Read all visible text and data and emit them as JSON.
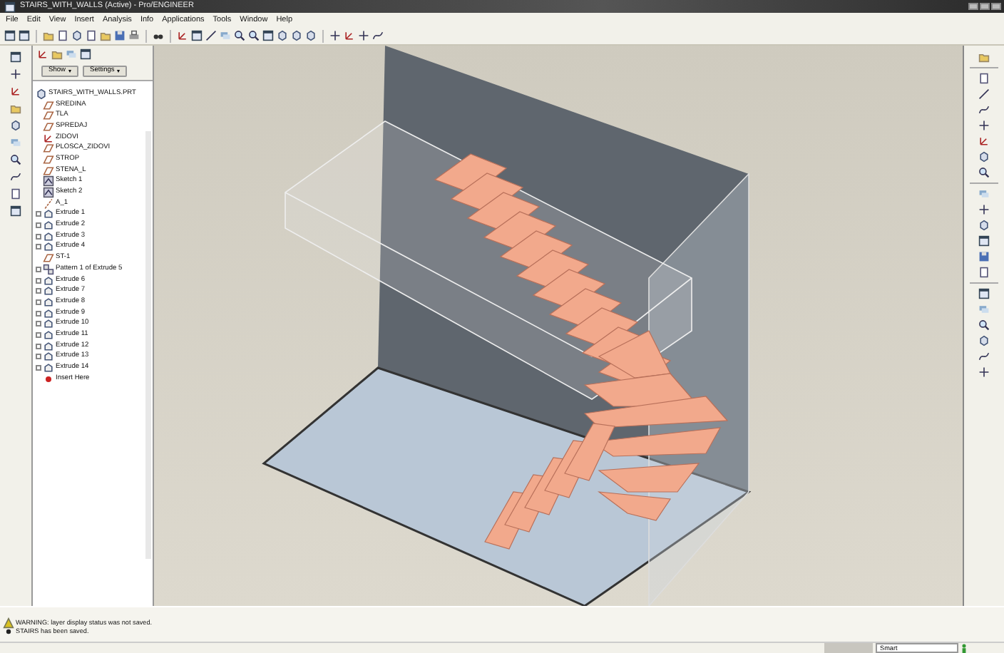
{
  "window": {
    "title": "STAIRS_WITH_WALLS (Active) - Pro/ENGINEER"
  },
  "menu": [
    "File",
    "Edit",
    "View",
    "Insert",
    "Analysis",
    "Info",
    "Applications",
    "Tools",
    "Window",
    "Help"
  ],
  "tree_panel": {
    "buttons": [
      "Show",
      "Settings"
    ],
    "items": [
      {
        "label": "STAIRS_WITH_WALLS.PRT",
        "kind": "part"
      },
      {
        "label": "SREDINA",
        "kind": "plane"
      },
      {
        "label": "TLA",
        "kind": "plane"
      },
      {
        "label": "SPREDAJ",
        "kind": "plane"
      },
      {
        "label": "ZIDOVI",
        "kind": "csys"
      },
      {
        "label": "PLOSCA_ZIDOVI",
        "kind": "plane"
      },
      {
        "label": "STROP",
        "kind": "plane"
      },
      {
        "label": "STENA_L",
        "kind": "plane"
      },
      {
        "label": "Sketch 1",
        "kind": "sketch"
      },
      {
        "label": "Sketch 2",
        "kind": "sketch"
      },
      {
        "label": "A_1",
        "kind": "axis"
      },
      {
        "label": "Extrude 1",
        "kind": "extrude"
      },
      {
        "label": "Extrude 2",
        "kind": "extrude"
      },
      {
        "label": "Extrude 3",
        "kind": "extrude"
      },
      {
        "label": "Extrude 4",
        "kind": "extrude"
      },
      {
        "label": "ST-1",
        "kind": "plane"
      },
      {
        "label": "Pattern 1 of Extrude 5",
        "kind": "pattern"
      },
      {
        "label": "Extrude 6",
        "kind": "extrude"
      },
      {
        "label": "Extrude 7",
        "kind": "extrude"
      },
      {
        "label": "Extrude 8",
        "kind": "extrude"
      },
      {
        "label": "Extrude 9",
        "kind": "extrude"
      },
      {
        "label": "Extrude 10",
        "kind": "extrude"
      },
      {
        "label": "Extrude 11",
        "kind": "extrude"
      },
      {
        "label": "Extrude 12",
        "kind": "extrude"
      },
      {
        "label": "Extrude 13",
        "kind": "extrude"
      },
      {
        "label": "Extrude 14",
        "kind": "extrude"
      },
      {
        "label": "Insert Here",
        "kind": "insert"
      }
    ]
  },
  "messages": [
    {
      "text": "WARNING: layer display status was not saved.",
      "kind": "warning"
    },
    {
      "text": "STAIRS has been saved.",
      "kind": "info"
    }
  ],
  "status_bar": {
    "filter": "Smart"
  }
}
